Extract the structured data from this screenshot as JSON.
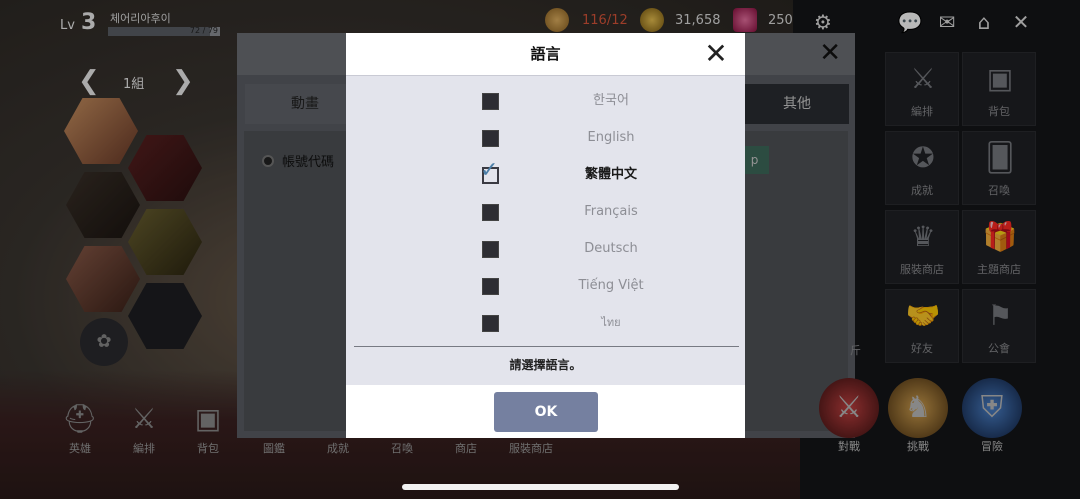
{
  "player": {
    "level_prefix": "Lv",
    "level": "3",
    "name": "체어리아후이",
    "exp_text": "72 / 79",
    "exp_progress": 0.91
  },
  "resources": {
    "stamina": "116/12",
    "gold": "31,658",
    "gems": "250"
  },
  "top_icons": [
    "gear-icon",
    "chat-icon",
    "mail-icon",
    "home-icon",
    "close-icon"
  ],
  "team": {
    "group_label": "1組",
    "prev_arrow": "❮",
    "next_arrow": "❯"
  },
  "settings_panel": {
    "tabs": [
      "動畫",
      "其他"
    ],
    "account_code_label": "帳號代碼",
    "copy_button_fragment": "p"
  },
  "right_menu": [
    {
      "label": "編排",
      "icon": "crossed-swords-icon"
    },
    {
      "label": "背包",
      "icon": "backpack-icon"
    },
    {
      "label": "成就",
      "icon": "medal-icon"
    },
    {
      "label": "召喚",
      "icon": "cards-icon"
    },
    {
      "label": "服裝商店",
      "icon": "costume-icon"
    },
    {
      "label": "主題商店",
      "icon": "gift-icon"
    },
    {
      "label": "好友",
      "icon": "handshake-icon"
    },
    {
      "label": "公會",
      "icon": "banner-icon"
    }
  ],
  "right_partial_labels": [
    "斤"
  ],
  "bottom_nav": [
    {
      "label": "英雄",
      "icon": "helmet-icon"
    },
    {
      "label": "編排",
      "icon": "crossed-swords-icon"
    },
    {
      "label": "背包",
      "icon": "backpack-icon"
    },
    {
      "label": "圖鑑",
      "icon": "book-icon"
    },
    {
      "label": "成就",
      "icon": "medal-icon"
    },
    {
      "label": "召喚",
      "icon": "cards-icon"
    },
    {
      "label": "商店",
      "icon": "shop-icon"
    },
    {
      "label": "服裝商店",
      "icon": "costume-icon"
    }
  ],
  "battle_nav": [
    {
      "label": "對戰",
      "icon": "pvp-icon"
    },
    {
      "label": "挑戰",
      "icon": "challenge-icon"
    },
    {
      "label": "冒險",
      "icon": "adventure-icon"
    }
  ],
  "language_dialog": {
    "title": "語言",
    "options": [
      {
        "name": "한국어",
        "checked": false
      },
      {
        "name": "English",
        "checked": false
      },
      {
        "name": "繁體中文",
        "checked": true
      },
      {
        "name": "Français",
        "checked": false
      },
      {
        "name": "Deutsch",
        "checked": false
      },
      {
        "name": "Tiếng Việt",
        "checked": false
      },
      {
        "name": "ไทย",
        "checked": false
      }
    ],
    "prompt": "請選擇語言。",
    "ok_label": "OK"
  },
  "colors": {
    "ok_button": "#7580a0",
    "checkmark": "#4c7fa8",
    "modal_body": "#e3e4ec",
    "exp_track": "#8e9196"
  }
}
